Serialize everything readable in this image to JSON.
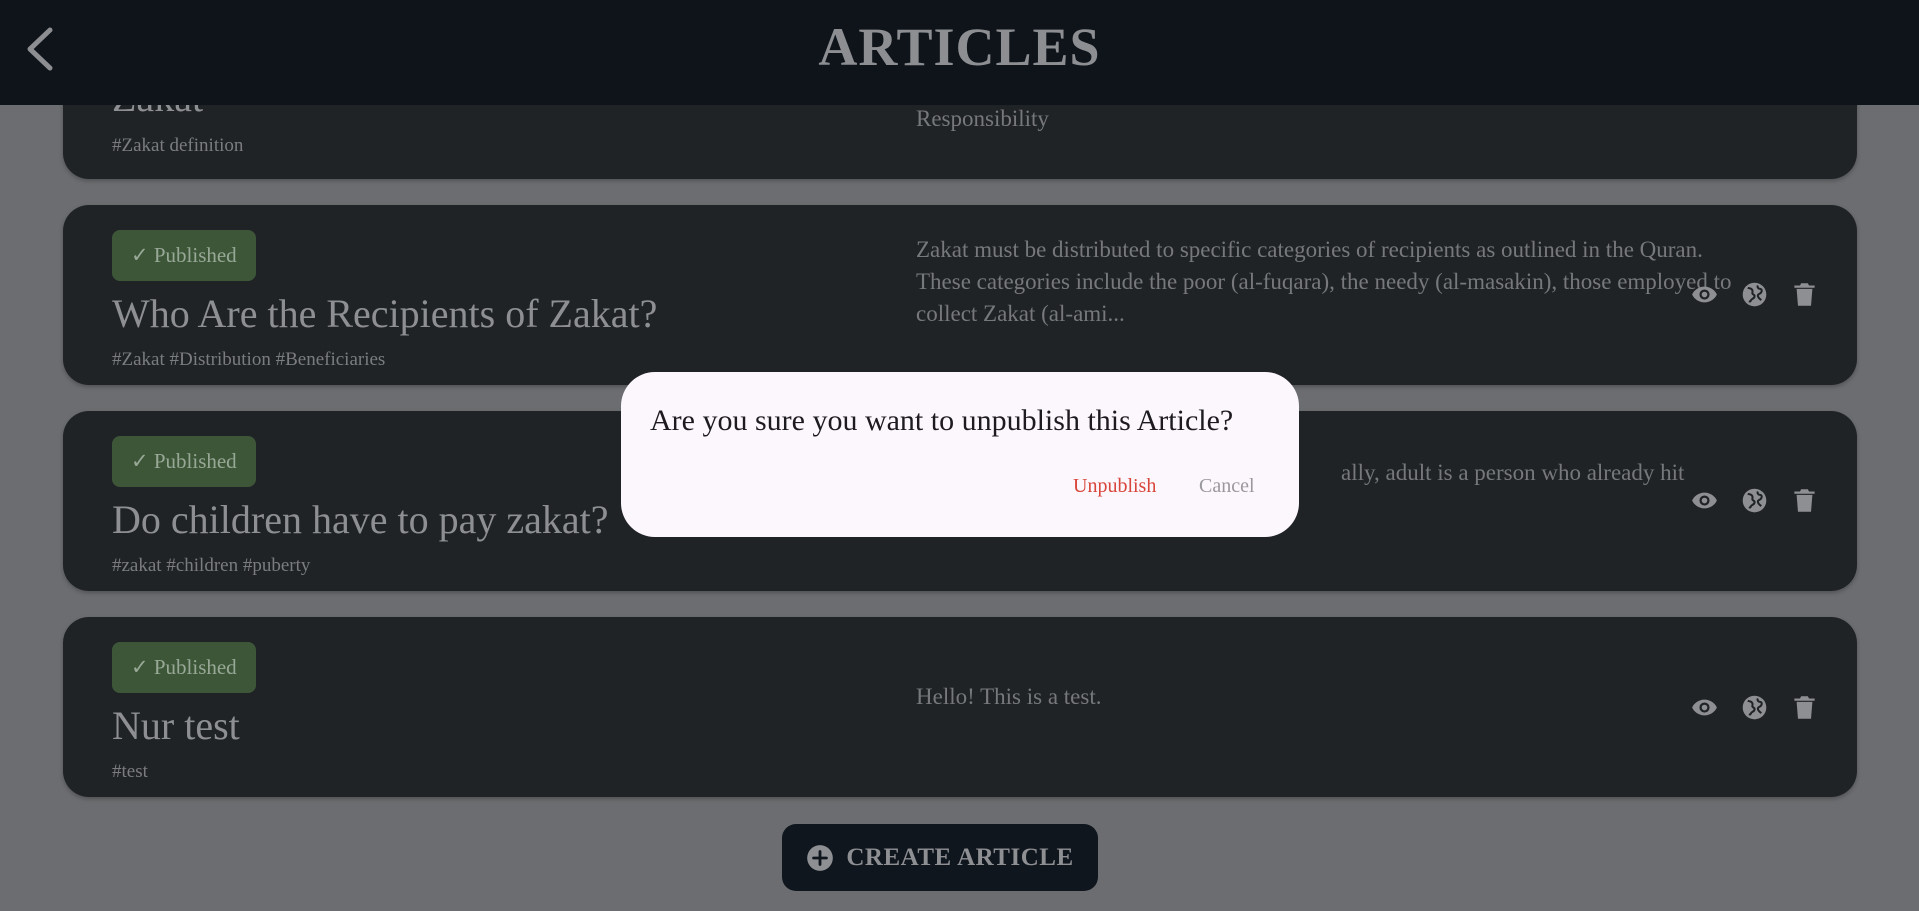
{
  "header": {
    "title": "ARTICLES",
    "back_icon": "chevron-left-icon"
  },
  "articles": [
    {
      "title": "Zakat",
      "tags": "#Zakat definition",
      "description": "Responsibility"
    },
    {
      "status": "✓ Published",
      "title": "Who Are the Recipients of Zakat?",
      "tags": "#Zakat #Distribution #Beneficiaries",
      "description_lines": [
        "Zakat must be distributed to specific categories of recipients as outlined in the Quran.",
        "These categories include the poor (al-fuqara), the needy (al-masakin), those employed to collect Zakat (al-ami..."
      ]
    },
    {
      "status": "✓ Published",
      "title": "Do children have to pay zakat?",
      "tags": "#zakat #children #puberty",
      "description": "ally, adult is a person who already hit"
    },
    {
      "status": "✓ Published",
      "title": "Nur test",
      "tags": "#test",
      "description": "Hello! This is a test."
    }
  ],
  "actions_icons": [
    "eye-icon",
    "globe-icon",
    "trash-icon"
  ],
  "create_button": {
    "label": "CREATE ARTICLE",
    "icon": "plus-circle-icon"
  },
  "dialog": {
    "message": "Are you sure you want to unpublish this Article?",
    "confirm_label": "Unpublish",
    "cancel_label": "Cancel"
  },
  "colors": {
    "accent_danger": "#d8453a",
    "published_badge": "#3d5638",
    "header_bg": "#0f141b",
    "dialog_bg": "#fcf7fd"
  }
}
